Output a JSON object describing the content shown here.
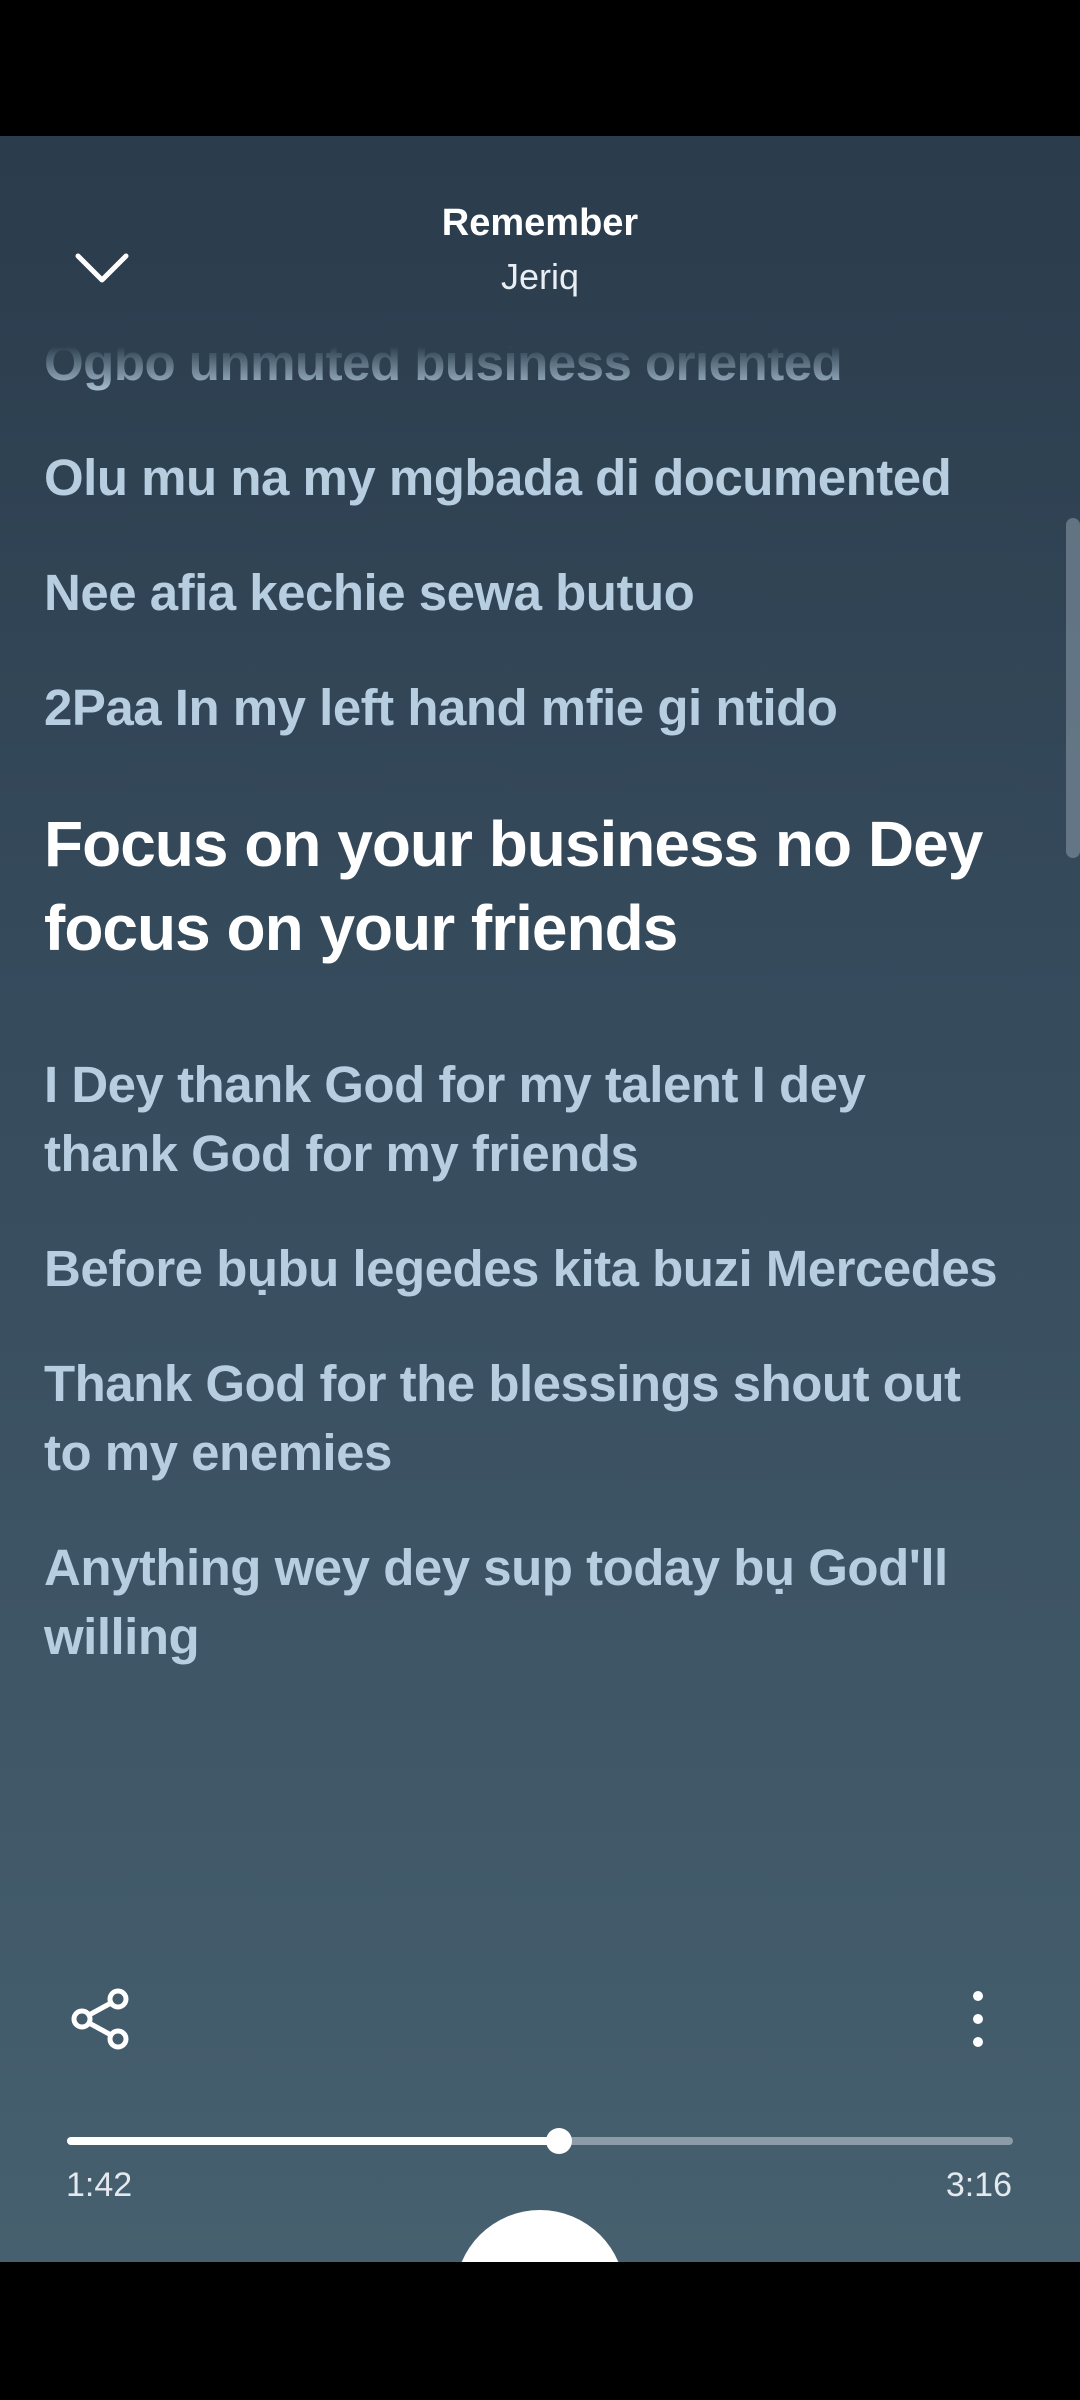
{
  "track": {
    "title": "Remember",
    "artist": "Jeriq"
  },
  "lyrics": [
    {
      "text": "Ogbo unmuted business oriented",
      "active": false
    },
    {
      "text": "Olu mu na my mgbada di documented",
      "active": false
    },
    {
      "text": "Nee afia kechie sewa butuo",
      "active": false
    },
    {
      "text": "2Paa In my left hand mfie gi ntido",
      "active": false
    },
    {
      "text": "Focus on your business no Dey focus on your friends",
      "active": true
    },
    {
      "text": "I Dey thank God for my talent I dey thank God for my friends",
      "active": false
    },
    {
      "text": "Before bụbu legedes kita buzi Mercedes",
      "active": false
    },
    {
      "text": "Thank God for the blessings shout out to my enemies",
      "active": false
    },
    {
      "text": "Anything wey dey sup today bụ God'll willing",
      "active": false
    }
  ],
  "playback": {
    "elapsed": "1:42",
    "total": "3:16",
    "progress": 0.52
  },
  "icons": {
    "collapse": "chevron-down-icon",
    "share": "share-icon",
    "more": "more-vertical-icon",
    "play": "play-button"
  },
  "colors": {
    "background_top": "#2b3c4c",
    "background_bottom": "#46606f",
    "lyric_inactive": "#b7cde0",
    "lyric_active": "#ffffff"
  }
}
